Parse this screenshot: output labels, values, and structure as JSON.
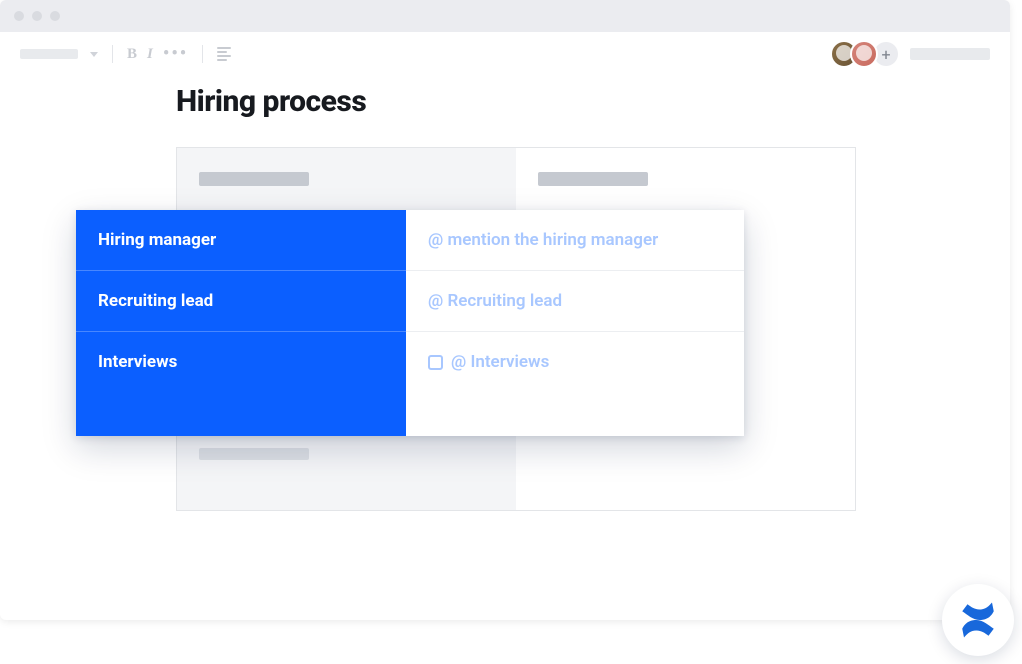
{
  "page": {
    "title": "Hiring process"
  },
  "popup": {
    "rows": [
      {
        "label": "Hiring manager",
        "value": "@ mention the hiring manager",
        "checkbox": false
      },
      {
        "label": "Recruiting lead",
        "value": "@ Recruiting lead",
        "checkbox": false
      },
      {
        "label": "Interviews",
        "value": "@ Interviews",
        "checkbox": true
      }
    ]
  },
  "toolbar": {
    "bold": "B",
    "italic": "I",
    "more": "•••",
    "add": "+"
  },
  "colors": {
    "accent": "#0b5fff",
    "placeholder": "#a8c7ff"
  }
}
